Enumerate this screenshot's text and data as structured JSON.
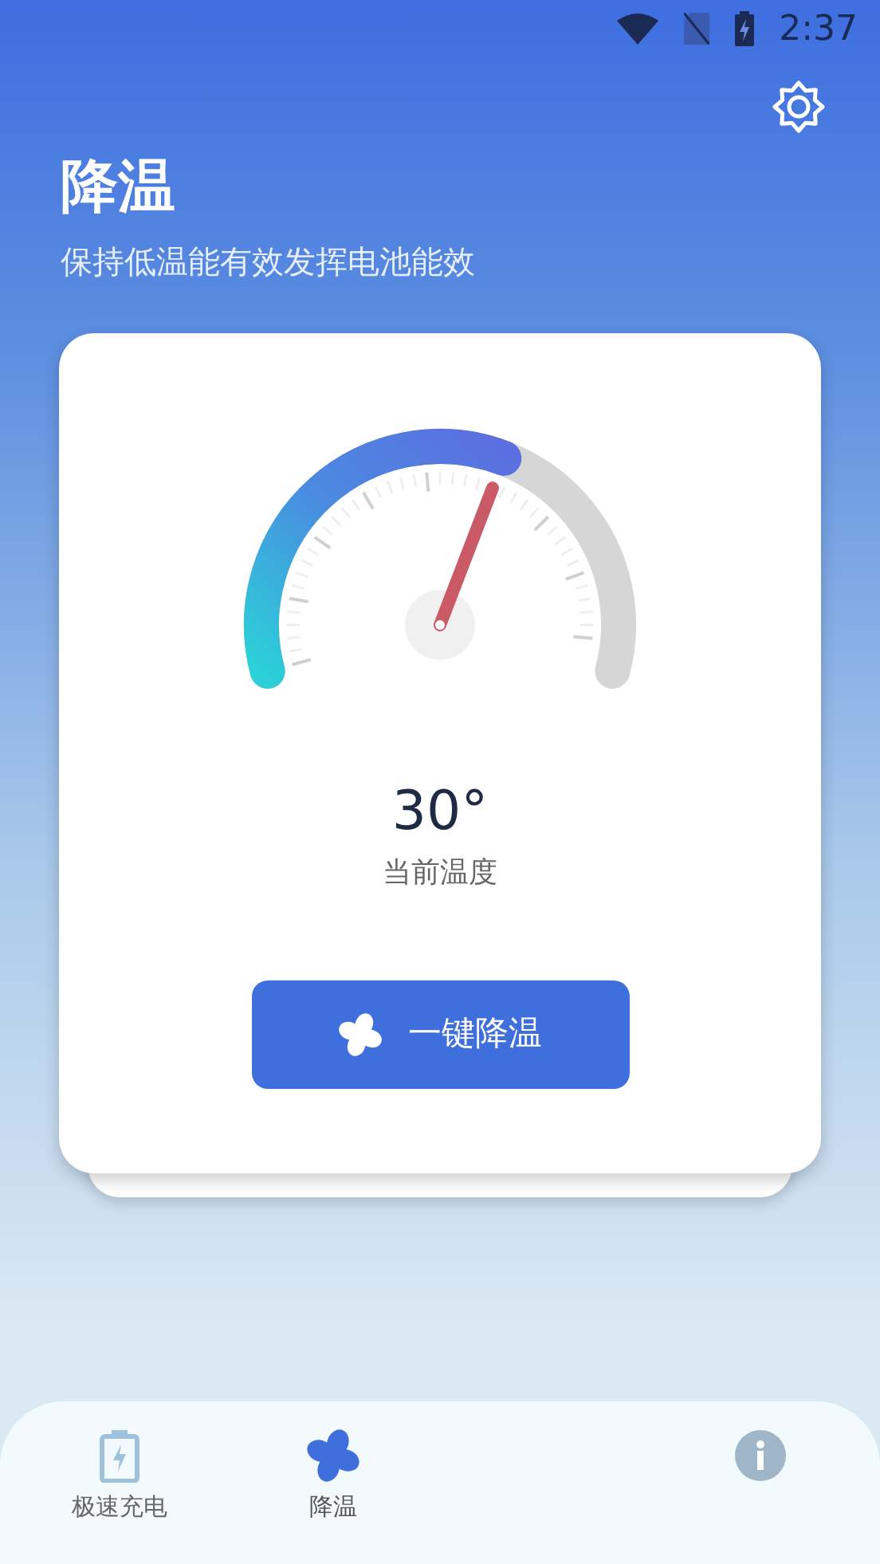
{
  "status_bar": {
    "time": "2:37"
  },
  "header": {
    "title": "降温",
    "subtitle": "保持低温能有效发挥电池能效"
  },
  "gauge": {
    "reading": "30°",
    "caption": "当前温度"
  },
  "action_button": {
    "label": "一键降温"
  },
  "bottom_nav": [
    {
      "kind": "battery",
      "label": "极速充电",
      "selected": false
    },
    {
      "kind": "fan",
      "label": "降温",
      "selected": true
    },
    {
      "kind": "hidden"
    },
    {
      "kind": "info"
    }
  ]
}
